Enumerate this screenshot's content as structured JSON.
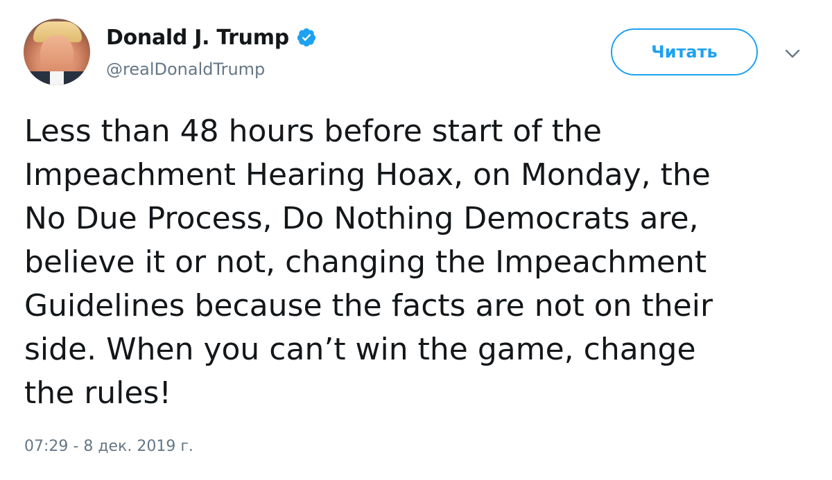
{
  "author": {
    "display_name": "Donald J. Trump",
    "handle": "@realDonaldTrump",
    "verified": true
  },
  "actions": {
    "follow_label": "Читать"
  },
  "tweet": {
    "text": "Less than 48 hours before start of the\nImpeachment Hearing Hoax, on Monday, the\nNo Due Process, Do Nothing Democrats are,\nbelieve it or not, changing the Impeachment\nGuidelines because the facts are not on their\nside. When you can’t win the game, change\nthe rules!",
    "timestamp": "07:29 - 8 дек. 2019 г."
  },
  "colors": {
    "accent": "#1da1f2",
    "text": "#14171a",
    "muted": "#657786"
  },
  "icons": {
    "verified": "verified-badge-icon",
    "caret": "chevron-down-icon"
  }
}
